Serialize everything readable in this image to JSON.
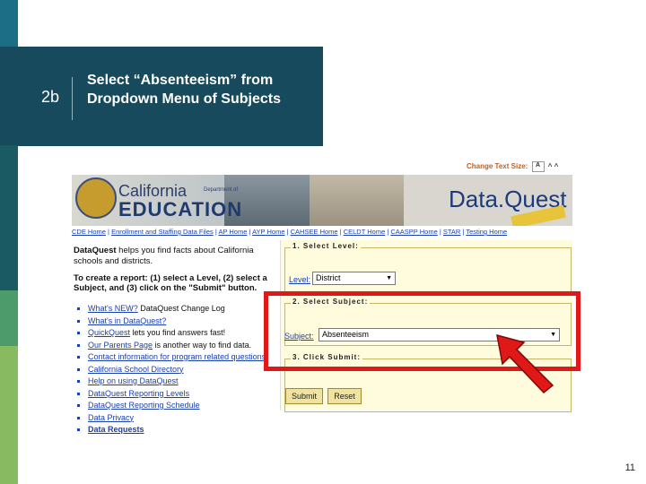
{
  "step": {
    "number": "2b",
    "title": "Select “Absenteeism” from Dropdown Menu of Subjects"
  },
  "page_number": "11",
  "screenshot": {
    "change_text_label": "Change Text Size:",
    "text_size_box": "A",
    "text_size_arrows": "^ ^",
    "banner": {
      "california": "California",
      "dept_of": "Department of",
      "education": "EDUCATION",
      "logo": "Data.Quest"
    },
    "nav_links": [
      "CDE Home",
      "Enrollment and Staffing Data Files",
      "AP Home",
      "AYP Home",
      "CAHSEE Home",
      "CELDT Home",
      "CAASPP Home",
      "STAR",
      "Testing Home"
    ],
    "intro": {
      "brand": "DataQuest",
      "text": " helps you find facts about California schools and districts."
    },
    "instructions": "To create a report: (1) select a Level, (2) select a Subject, and (3) click on the \"Submit\" button.",
    "links": [
      {
        "link": "What's NEW?",
        "text": " DataQuest Change Log"
      },
      {
        "link": "What's in DataQuest?",
        "text": ""
      },
      {
        "link": "QuickQuest",
        "text": " lets you find answers fast!"
      },
      {
        "link": "Our Parents Page",
        "text": " is another way to find data."
      },
      {
        "link": "Contact information for program related questions",
        "text": ""
      },
      {
        "link": "California School Directory",
        "text": ""
      },
      {
        "link": "Help on using DataQuest",
        "text": ""
      },
      {
        "link": "DataQuest Reporting Levels",
        "text": ""
      },
      {
        "link": "DataQuest Reporting Schedule",
        "text": ""
      },
      {
        "link": "Data Privacy",
        "text": ""
      },
      {
        "link": "Data Requests",
        "text": ""
      }
    ],
    "form": {
      "section1": "1. Select Level:",
      "level_label": "Level:",
      "level_value": "District",
      "section2": "2. Select Subject:",
      "subject_label": "Subject:",
      "subject_value": "Absenteeism",
      "section3": "3. Click Submit:",
      "submit": "Submit",
      "reset": "Reset"
    }
  },
  "colors": {
    "header_bg": "#174a5c",
    "highlight": "#e01818",
    "panel_bg": "#fffbdd"
  }
}
